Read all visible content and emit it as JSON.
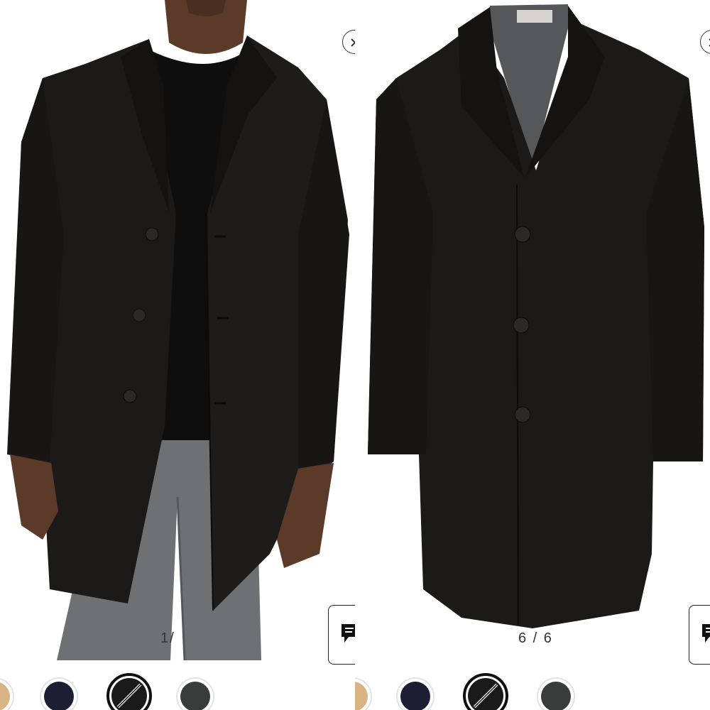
{
  "left_panel": {
    "counter": "1/",
    "close_icon": "close-icon",
    "chat_icon": "chat-icon",
    "swatches": [
      {
        "name": "camel",
        "color": "#D9B483",
        "selected": false
      },
      {
        "name": "navy",
        "color": "#1C1F33",
        "selected": false
      },
      {
        "name": "black",
        "color": "#1A1A1A",
        "selected": true
      },
      {
        "name": "charcoal",
        "color": "#3A3C3C",
        "selected": false
      }
    ]
  },
  "right_panel": {
    "counter": "6 / 6",
    "close_icon": "close-icon",
    "chat_icon": "chat-icon",
    "swatches": [
      {
        "name": "camel",
        "color": "#D9B483",
        "selected": false
      },
      {
        "name": "navy",
        "color": "#1C1F33",
        "selected": false
      },
      {
        "name": "black",
        "color": "#1A1A1A",
        "selected": true
      },
      {
        "name": "charcoal",
        "color": "#3A3C3C",
        "selected": false
      }
    ]
  },
  "colors": {
    "coat": "#1b1a19",
    "sweater": "#0f0e0e",
    "skin": "#5b3a2a",
    "trousers": "#6f7073",
    "lining": "#55575a"
  }
}
